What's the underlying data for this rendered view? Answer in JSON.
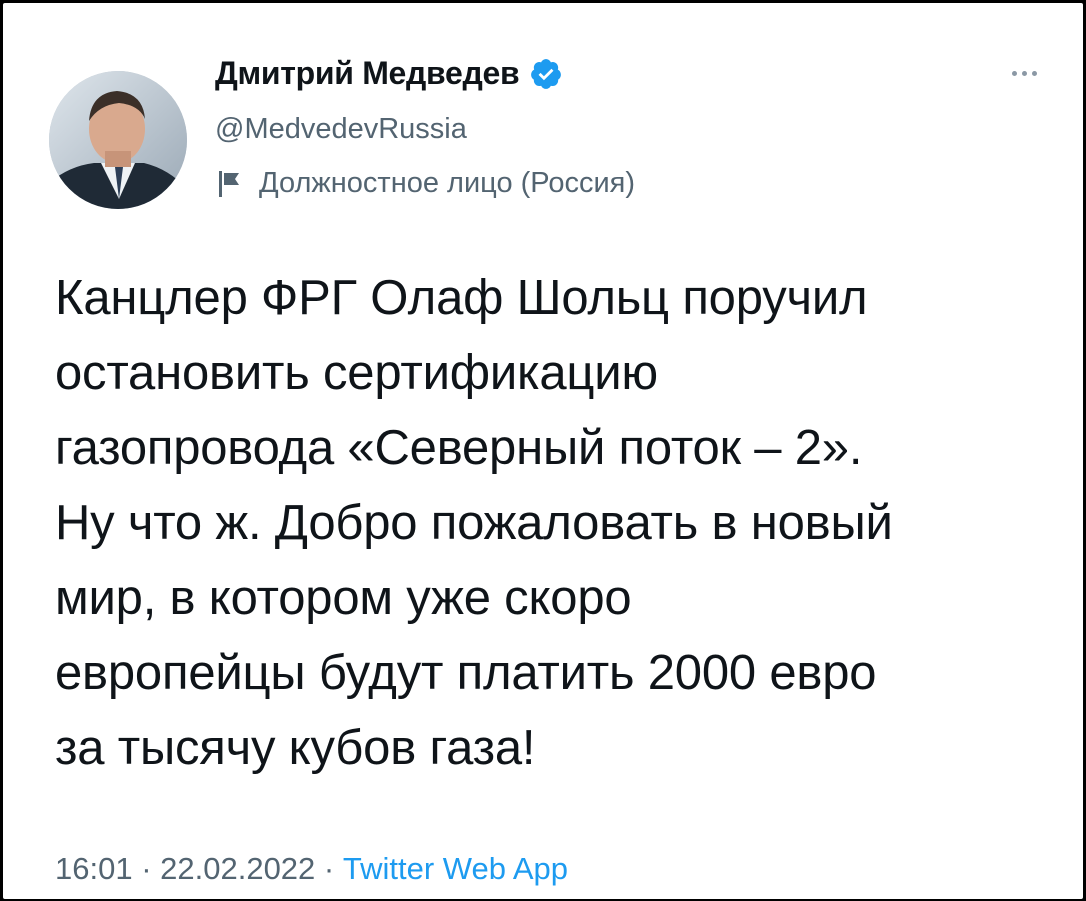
{
  "tweet": {
    "author": {
      "name": "Дмитрий Медведев",
      "handle": "@MedvedevRussia",
      "verified": true,
      "label": "Должностное лицо (Россия)",
      "label_icon": "flag-icon"
    },
    "text_lines": [
      "Канцлер ФРГ Олаф Шольц поручил",
      "остановить сертификацию",
      "газопровода «Северный поток – 2».",
      "Ну что ж. Добро пожаловать в новый",
      "мир, в котором уже скоро",
      "европейцы будут платить 2000 евро",
      "за тысячу кубов газа!"
    ],
    "time": "16:01",
    "separator": " · ",
    "date": "22.02.2022",
    "source": "Twitter Web App",
    "colors": {
      "text": "#0f1419",
      "secondary": "#536471",
      "accent": "#1d9bf0"
    }
  }
}
